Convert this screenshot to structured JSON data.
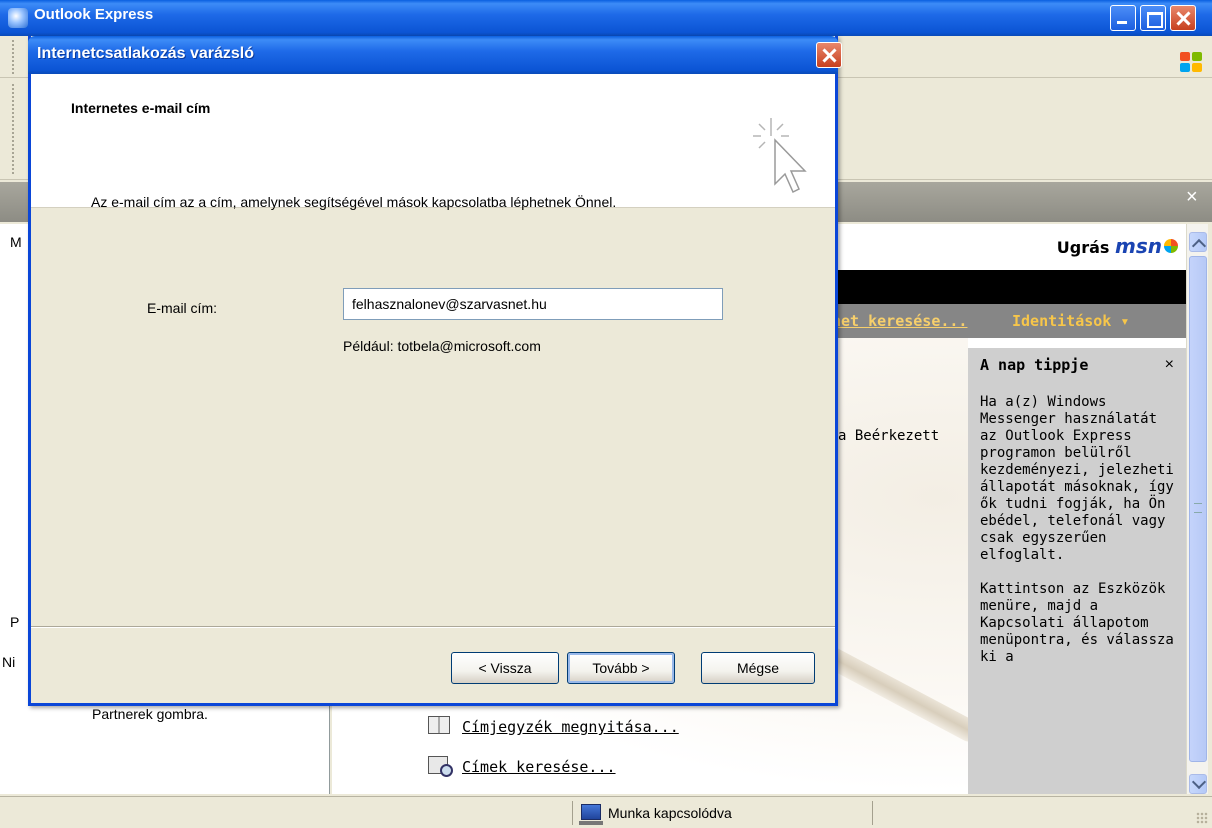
{
  "background_window": {
    "title": "Outlook Express",
    "msn": {
      "jump_label": "Ugrás",
      "logo": "msn"
    },
    "grey_link": "net keresése...",
    "identities_menu": "Identitások ▾",
    "content_text_fragment": "a Beérkezett",
    "left_pane": {
      "letters": [
        "M",
        "P",
        "Ni"
      ],
      "partner_text": "Partnerek gombra."
    },
    "links": {
      "address_book": "Címjegyzék megnyitása...",
      "find_people": "Címek keresése..."
    },
    "tip": {
      "title": "A nap tippje",
      "close": "×",
      "paragraph1": "Ha a(z) Windows Messenger használatát az Outlook Express programon belülről kezdeményezi, jelezheti állapotát másoknak, így ők tudni fogják, ha Ön ebédel, telefonál vagy csak egyszerűen elfoglalt.",
      "paragraph2": "Kattintson az Eszközök menüre, majd a Kapcsolati állapotom menüpontra, és válassza ki a"
    },
    "folderbar_close": "×",
    "status": {
      "connection": "Munka kapcsolódva"
    }
  },
  "wizard": {
    "title": "Internetcsatlakozás varázsló",
    "heading": "Internetes e-mail cím",
    "description": "Az e-mail cím az a cím, amelynek segítségével mások kapcsolatba léphetnek Önnel.",
    "email_label": "E-mail cím:",
    "email_value": "felhasznalonev@szarvasnet.hu",
    "example": "Például: totbela@microsoft.com",
    "buttons": {
      "back": "< Vissza",
      "next": "Tovább >",
      "cancel": "Mégse"
    }
  },
  "colors": {
    "xp_blue": "#0a5fe0",
    "face": "#ece9d8",
    "tip_bg": "#cfcfcf",
    "link_gold": "#f7cf6b"
  }
}
